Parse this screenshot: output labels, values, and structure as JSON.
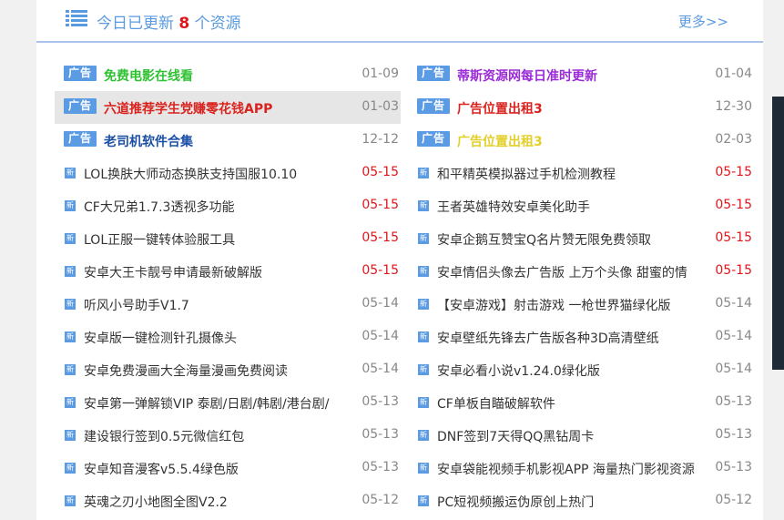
{
  "header": {
    "title_pre": "今日已更新",
    "count": "8",
    "title_post": "个资源",
    "more": "更多>>"
  },
  "colors": {
    "accent": "#5a9be0",
    "badge": "#5b9be3",
    "highlight_date": "#e0161b",
    "ad_green": "#2fc132",
    "ad_purple": "#9b2bd6",
    "ad_red": "#d8231e",
    "ad_blue": "#1c4fa6",
    "ad_yellow": "#e3cf2a",
    "sidebar_dark": "#1e2a36"
  },
  "left": [
    {
      "type": "ad",
      "badge": "广告",
      "title": "免费电影在线看",
      "date": "01-09",
      "color": "#2fc132"
    },
    {
      "type": "ad",
      "badge": "广告",
      "title": "六道推荐学生党赚零花钱APP",
      "date": "01-03",
      "color": "#d8231e",
      "highlight": true
    },
    {
      "type": "ad",
      "badge": "广告",
      "title": "老司机软件合集",
      "date": "12-12",
      "color": "#1c4fa6"
    },
    {
      "type": "new",
      "badge": "新",
      "title": "LOL换肤大师动态换肤支持国服10.10",
      "date": "05-15",
      "red": true
    },
    {
      "type": "new",
      "badge": "新",
      "title": "CF大兄弟1.7.3透视多功能",
      "date": "05-15",
      "red": true
    },
    {
      "type": "new",
      "badge": "新",
      "title": "LOL正服一键转体验服工具",
      "date": "05-15",
      "red": true
    },
    {
      "type": "new",
      "badge": "新",
      "title": "安卓大王卡靓号申请最新破解版",
      "date": "05-15",
      "red": true
    },
    {
      "type": "new",
      "badge": "新",
      "title": "听风小号助手V1.7",
      "date": "05-14"
    },
    {
      "type": "new",
      "badge": "新",
      "title": "安卓版一键检测针孔摄像头",
      "date": "05-14"
    },
    {
      "type": "new",
      "badge": "新",
      "title": "安卓免费漫画大全海量漫画免费阅读",
      "date": "05-14"
    },
    {
      "type": "new",
      "badge": "新",
      "title": "安卓第一弹解锁VIP  泰剧/日剧/韩剧/港台剧/",
      "date": "05-13"
    },
    {
      "type": "new",
      "badge": "新",
      "title": "建设银行签到0.5元微信红包",
      "date": "05-13"
    },
    {
      "type": "new",
      "badge": "新",
      "title": "安卓知音漫客v5.5.4绿色版",
      "date": "05-13"
    },
    {
      "type": "new",
      "badge": "新",
      "title": "英魂之刃小地图全图V2.2",
      "date": "05-12"
    }
  ],
  "right": [
    {
      "type": "ad",
      "badge": "广告",
      "title": "蒂斯资源网每日准时更新",
      "date": "01-04",
      "color": "#9b2bd6"
    },
    {
      "type": "ad",
      "badge": "广告",
      "title": "广告位置出租3",
      "date": "12-30",
      "color": "#d8231e"
    },
    {
      "type": "ad",
      "badge": "广告",
      "title": "广告位置出租3",
      "date": "02-03",
      "color": "#e3cf2a"
    },
    {
      "type": "new",
      "badge": "新",
      "title": "和平精英模拟器过手机检测教程",
      "date": "05-15",
      "red": true
    },
    {
      "type": "new",
      "badge": "新",
      "title": "王者英雄特效安卓美化助手",
      "date": "05-15",
      "red": true
    },
    {
      "type": "new",
      "badge": "新",
      "title": "安卓企鹅互赞宝Q名片赞无限免费领取",
      "date": "05-15",
      "red": true
    },
    {
      "type": "new",
      "badge": "新",
      "title": "安卓情侣头像去广告版  上万个头像  甜蜜的情",
      "date": "05-15",
      "red": true
    },
    {
      "type": "new",
      "badge": "新",
      "title": "【安卓游戏】射击游戏 一枪世界猫绿化版",
      "date": "05-14"
    },
    {
      "type": "new",
      "badge": "新",
      "title": "安卓壁纸先锋去广告版各种3D高清壁纸",
      "date": "05-14"
    },
    {
      "type": "new",
      "badge": "新",
      "title": "安卓必看小说v1.24.0绿化版",
      "date": "05-14"
    },
    {
      "type": "new",
      "badge": "新",
      "title": "CF单板自瞄破解软件",
      "date": "05-13"
    },
    {
      "type": "new",
      "badge": "新",
      "title": "DNF签到7天得QQ黑钻周卡",
      "date": "05-13"
    },
    {
      "type": "new",
      "badge": "新",
      "title": "安卓袋能视频手机影视APP  海量热门影视资源",
      "date": "05-13"
    },
    {
      "type": "new",
      "badge": "新",
      "title": "PC短视频搬运伪原创上热门",
      "date": "05-12"
    }
  ]
}
